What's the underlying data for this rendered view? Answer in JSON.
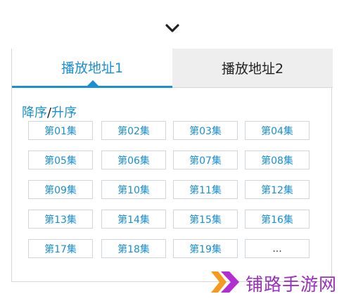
{
  "collapse_icon": "chevron-down-icon",
  "tabs": [
    {
      "label": "播放地址1",
      "active": true
    },
    {
      "label": "播放地址2",
      "active": false
    }
  ],
  "sort": {
    "desc": "降序",
    "sep": "/",
    "asc": "升序"
  },
  "episodes": [
    "第01集",
    "第02集",
    "第03集",
    "第04集",
    "第05集",
    "第06集",
    "第07集",
    "第08集",
    "第09集",
    "第10集",
    "第11集",
    "第12集",
    "第13集",
    "第14集",
    "第15集",
    "第16集",
    "第17集",
    "第18集",
    "第19集",
    "..."
  ],
  "watermark": {
    "text": "铺路手游网"
  },
  "colors": {
    "accent": "#1a8fd2",
    "tab_inactive_bg": "#eeeeee",
    "logo": "#9b2fbf",
    "logo_orange": "#f39b1e"
  }
}
